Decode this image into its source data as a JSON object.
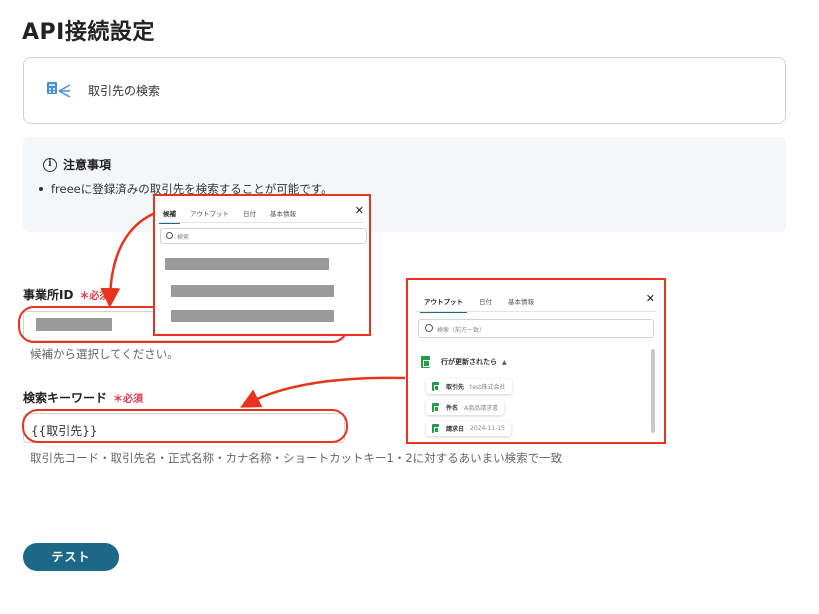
{
  "page": {
    "title": "API接続設定"
  },
  "action": {
    "label": "取引先の検索",
    "icon": "calculator-icon"
  },
  "notice": {
    "title": "注意事項",
    "items": [
      "freeeに登録済みの取引先を検索することが可能です。"
    ]
  },
  "fields": {
    "office_id": {
      "label": "事業所ID",
      "required": "＊必須",
      "helper": "候補から選択してください。"
    },
    "keyword": {
      "label": "検索キーワード",
      "required": "＊必須",
      "value": "{{取引先}}",
      "helper": "取引先コード・取引先名・正式名称・カナ名称・ショートカットキー1・2に対するあいまい検索で一致"
    }
  },
  "button": {
    "test": "テスト"
  },
  "popup_candidates": {
    "tabs": [
      "候補",
      "アウトプット",
      "日付",
      "基本情報"
    ],
    "search_placeholder": "検索"
  },
  "popup_output": {
    "tabs": [
      "アウトプット",
      "日付",
      "基本情報"
    ],
    "search_placeholder": "検索（前方一致）",
    "group": "行が更新されたら",
    "rows": [
      {
        "key": "取引先",
        "value": "test株式会社"
      },
      {
        "key": "件名",
        "value": "A商品請求書"
      },
      {
        "key": "請求日",
        "value": "2024-11-15"
      }
    ]
  },
  "colors": {
    "accent": "#1c6886",
    "highlight": "#e8341f",
    "required": "#e0364b",
    "sheet_green": "#1e9e4a"
  }
}
